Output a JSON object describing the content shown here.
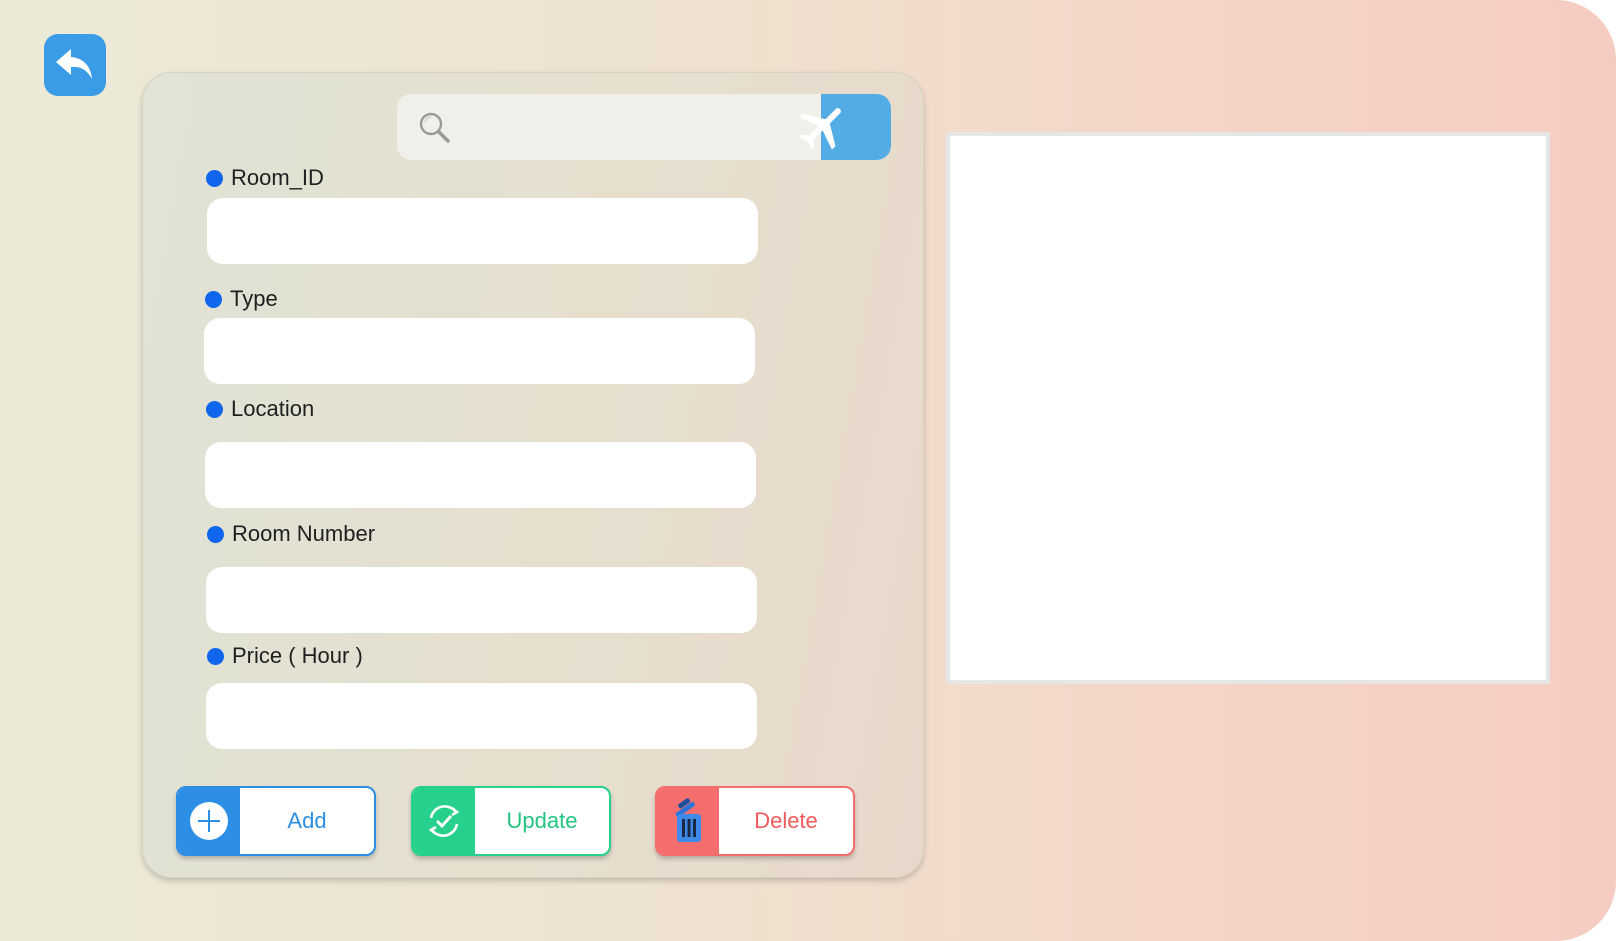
{
  "search": {
    "value": "",
    "placeholder": ""
  },
  "fields": [
    {
      "label": "Room_ID",
      "value": ""
    },
    {
      "label": "Type",
      "value": ""
    },
    {
      "label": "Location",
      "value": ""
    },
    {
      "label": "Room Number",
      "value": ""
    },
    {
      "label": "Price ( Hour )",
      "value": ""
    }
  ],
  "buttons": {
    "add": "Add",
    "update": "Update",
    "delete": "Delete"
  },
  "icons": {
    "back": "back-arrow-icon",
    "search": "search-icon",
    "search_go": "airplane-icon",
    "add": "plus-circle-icon",
    "update": "refresh-check-icon",
    "delete": "trash-icon"
  },
  "colors": {
    "accent_blue": "#2d8ee6",
    "update_green": "#27d18b",
    "delete_red": "#f56e6e",
    "label_dot": "#1166ee"
  }
}
